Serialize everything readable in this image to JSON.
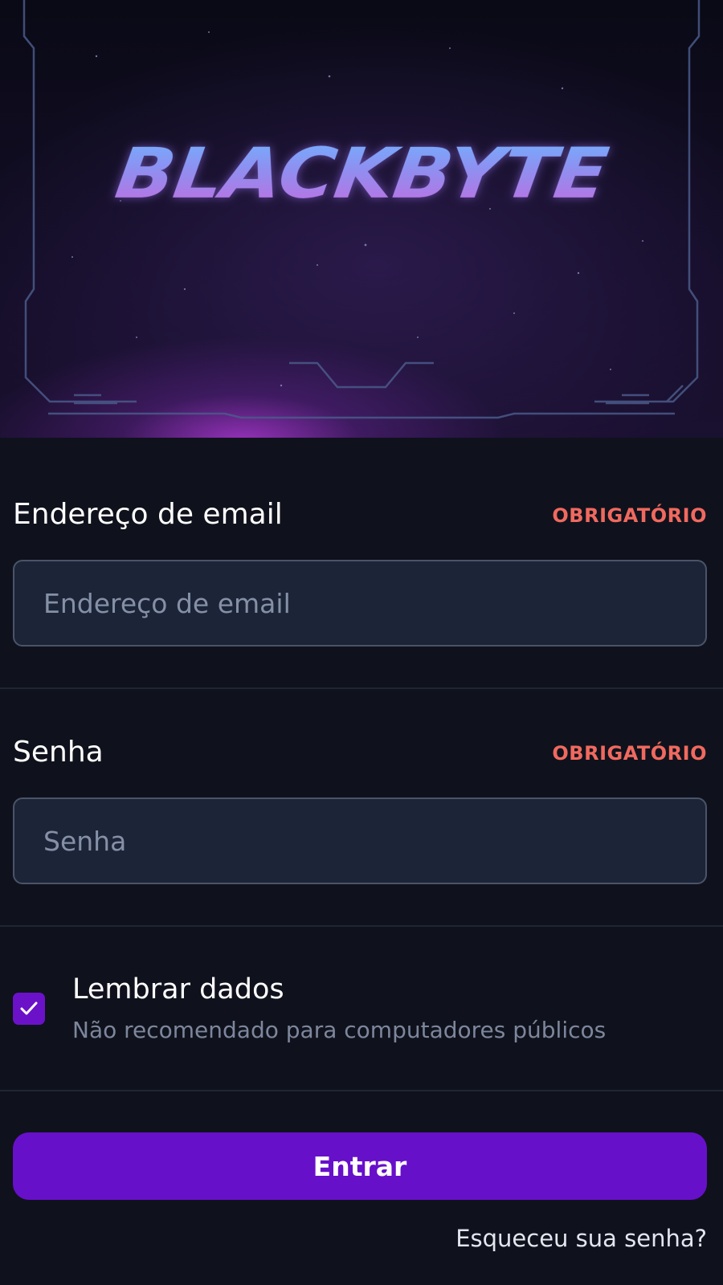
{
  "banner": {
    "logo_text": "BLACKBYTE"
  },
  "email": {
    "label": "Endereço de email",
    "required": "OBRIGATÓRIO",
    "placeholder": "Endereço de email",
    "value": ""
  },
  "password": {
    "label": "Senha",
    "required": "OBRIGATÓRIO",
    "placeholder": "Senha",
    "value": ""
  },
  "remember": {
    "title": "Lembrar dados",
    "subtitle": "Não recomendado para computadores públicos",
    "checked": true,
    "check_icon": "check-icon"
  },
  "submit": {
    "label": "Entrar"
  },
  "forgot": {
    "label": "Esqueceu sua senha?"
  },
  "colors": {
    "background": "#0f121c",
    "accent": "#6710c9",
    "required": "#f0695f",
    "input_bg": "#1c2438"
  }
}
